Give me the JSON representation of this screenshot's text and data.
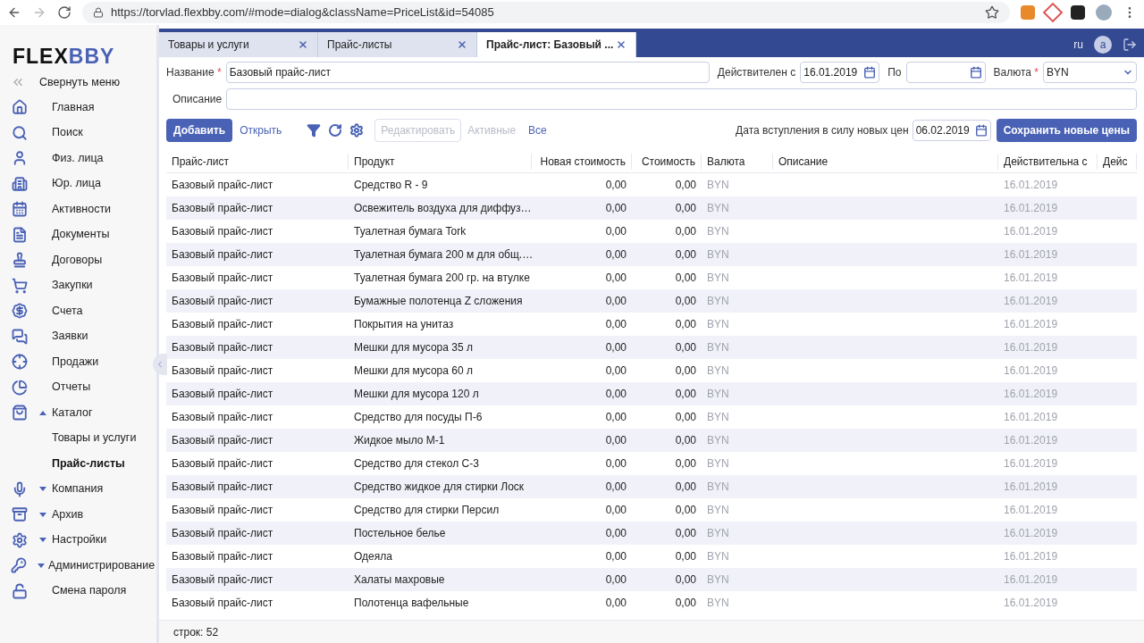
{
  "browser": {
    "url": "https://torvlad.flexbby.com/#mode=dialog&className=PriceList&id=54085"
  },
  "logo": {
    "left": "FLEX",
    "right": "BBY"
  },
  "sidebar": {
    "collapse": "Свернуть меню",
    "items": [
      {
        "label": "Главная",
        "kind": "item"
      },
      {
        "label": "Поиск",
        "kind": "item"
      },
      {
        "label": "Физ. лица",
        "kind": "item"
      },
      {
        "label": "Юр. лица",
        "kind": "item"
      },
      {
        "label": "Активности",
        "kind": "item"
      },
      {
        "label": "Документы",
        "kind": "item"
      },
      {
        "label": "Договоры",
        "kind": "item"
      },
      {
        "label": "Закупки",
        "kind": "item"
      },
      {
        "label": "Счета",
        "kind": "item"
      },
      {
        "label": "Заявки",
        "kind": "item"
      },
      {
        "label": "Продажи",
        "kind": "item"
      },
      {
        "label": "Отчеты",
        "kind": "item"
      },
      {
        "label": "Каталог",
        "kind": "group",
        "expanded": true,
        "children": [
          {
            "label": "Товары и услуги",
            "selected": false
          },
          {
            "label": "Прайс-листы",
            "selected": true
          }
        ]
      },
      {
        "label": "Компания",
        "kind": "group",
        "expanded": false
      },
      {
        "label": "Архив",
        "kind": "group",
        "expanded": false
      },
      {
        "label": "Настройки",
        "kind": "group",
        "expanded": false
      },
      {
        "label": "Администрирование",
        "kind": "group",
        "expanded": false
      },
      {
        "label": "Смена пароля",
        "kind": "item"
      }
    ]
  },
  "tabs": [
    {
      "label": "Товары и услуги",
      "selected": false
    },
    {
      "label": "Прайс-листы",
      "selected": false
    },
    {
      "label": "Прайс-лист: Базовый ...",
      "selected": true
    }
  ],
  "header": {
    "language": "ru",
    "avatar": "a"
  },
  "form": {
    "name_label": "Название",
    "name_required": "*",
    "name_value": "Базовый прайс-лист",
    "valid_from_label": "Действителен с",
    "valid_from": "16.01.2019",
    "to_label": "По",
    "currency_label": "Валюта",
    "currency_required": "*",
    "currency": "BYN",
    "description_label": "Описание"
  },
  "toolbar": {
    "add": "Добавить",
    "open": "Открыть",
    "edit": "Редактировать",
    "active": "Активные",
    "all": "Все",
    "date_label": "Дата вступления в силу новых цен",
    "date": "06.02.2019",
    "save": "Сохранить новые цены"
  },
  "table": {
    "columns": [
      "Прайс-лист",
      "Продукт",
      "Новая стоимость",
      "Стоимость",
      "Валюта",
      "Описание",
      "Действительна с",
      "Дейс"
    ],
    "rows": [
      [
        "Базовый прайс-лист",
        "Средство R - 9",
        "0,00",
        "0,00",
        "BYN",
        "16.01.2019"
      ],
      [
        "Базовый прайс-лист",
        "Освежитель воздуха для диффуз…",
        "0,00",
        "0,00",
        "BYN",
        "16.01.2019"
      ],
      [
        "Базовый прайс-лист",
        "Туалетная бумага Tork",
        "0,00",
        "0,00",
        "BYN",
        "16.01.2019"
      ],
      [
        "Базовый прайс-лист",
        "Туалетная бумага 200 м для общ.…",
        "0,00",
        "0,00",
        "BYN",
        "16.01.2019"
      ],
      [
        "Базовый прайс-лист",
        "Туалетная бумага 200 гр. на втулке",
        "0,00",
        "0,00",
        "BYN",
        "16.01.2019"
      ],
      [
        "Базовый прайс-лист",
        "Бумажные полотенца Z сложения",
        "0,00",
        "0,00",
        "BYN",
        "16.01.2019"
      ],
      [
        "Базовый прайс-лист",
        "Покрытия на унитаз",
        "0,00",
        "0,00",
        "BYN",
        "16.01.2019"
      ],
      [
        "Базовый прайс-лист",
        "Мешки для мусора 35 л",
        "0,00",
        "0,00",
        "BYN",
        "16.01.2019"
      ],
      [
        "Базовый прайс-лист",
        "Мешки для мусора 60 л",
        "0,00",
        "0,00",
        "BYN",
        "16.01.2019"
      ],
      [
        "Базовый прайс-лист",
        "Мешки для мусора 120 л",
        "0,00",
        "0,00",
        "BYN",
        "16.01.2019"
      ],
      [
        "Базовый прайс-лист",
        "Средство для посуды П-6",
        "0,00",
        "0,00",
        "BYN",
        "16.01.2019"
      ],
      [
        "Базовый прайс-лист",
        "Жидкое мыло М-1",
        "0,00",
        "0,00",
        "BYN",
        "16.01.2019"
      ],
      [
        "Базовый прайс-лист",
        "Средство для стекол С-3",
        "0,00",
        "0,00",
        "BYN",
        "16.01.2019"
      ],
      [
        "Базовый прайс-лист",
        "Средство жидкое для стирки Лоск",
        "0,00",
        "0,00",
        "BYN",
        "16.01.2019"
      ],
      [
        "Базовый прайс-лист",
        "Средство для стирки Персил",
        "0,00",
        "0,00",
        "BYN",
        "16.01.2019"
      ],
      [
        "Базовый прайс-лист",
        "Постельное белье",
        "0,00",
        "0,00",
        "BYN",
        "16.01.2019"
      ],
      [
        "Базовый прайс-лист",
        "Одеяла",
        "0,00",
        "0,00",
        "BYN",
        "16.01.2019"
      ],
      [
        "Базовый прайс-лист",
        "Халаты махровые",
        "0,00",
        "0,00",
        "BYN",
        "16.01.2019"
      ],
      [
        "Базовый прайс-лист",
        "Полотенца вафельные",
        "0,00",
        "0,00",
        "BYN",
        "16.01.2019"
      ]
    ]
  },
  "status_bar": "строк: 52"
}
